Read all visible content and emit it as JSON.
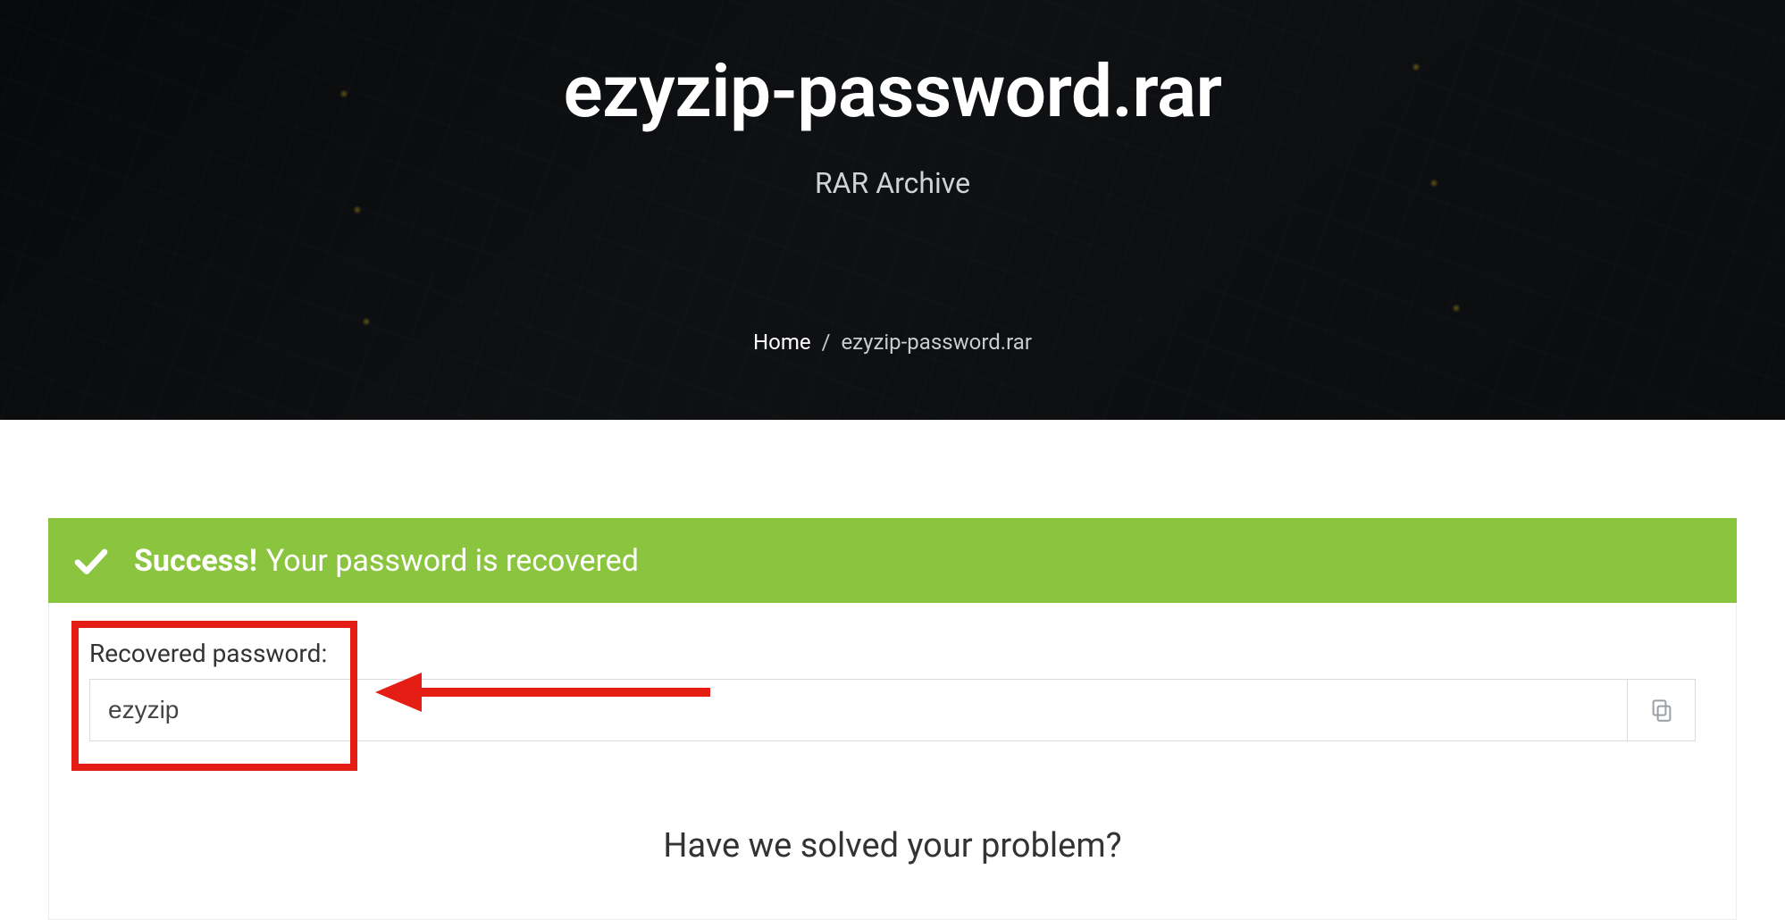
{
  "hero": {
    "title": "ezyzip-password.rar",
    "subtitle": "RAR Archive"
  },
  "breadcrumb": {
    "home": "Home",
    "current": "ezyzip-password.rar"
  },
  "alert": {
    "strong": "Success!",
    "message": "Your password is recovered"
  },
  "result": {
    "label": "Recovered password:",
    "value": "ezyzip"
  },
  "question": "Have we solved your problem?",
  "colors": {
    "success_bg": "#8bc53f",
    "annotation_red": "#e41e14"
  }
}
